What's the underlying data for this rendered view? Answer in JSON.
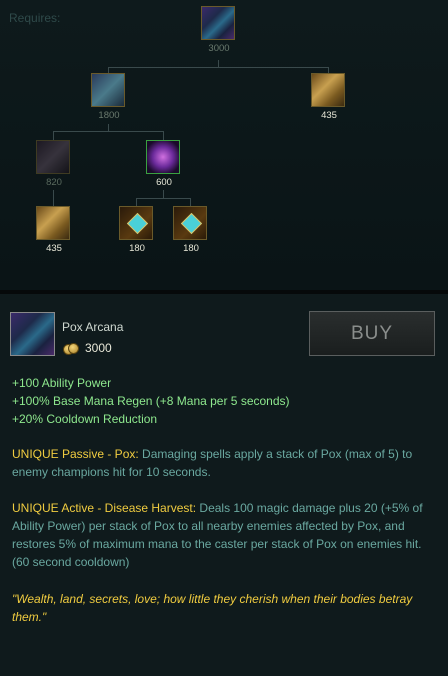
{
  "tree": {
    "requires_label": "Requires:",
    "root": {
      "icon": "pox-arcana-icon",
      "price": "3000"
    },
    "level1": [
      {
        "icon": "blue-tome-icon",
        "price": "1800"
      },
      {
        "icon": "golden-book-icon",
        "price": "435"
      }
    ],
    "level2": [
      {
        "icon": "dark-tome-icon",
        "price": "820"
      },
      {
        "icon": "purple-orb-icon",
        "price": "600"
      }
    ],
    "level3": [
      {
        "icon": "golden-book-icon",
        "price": "435"
      },
      {
        "icon": "blue-gem-icon",
        "price": "180"
      },
      {
        "icon": "blue-gem-icon",
        "price": "180"
      }
    ]
  },
  "item": {
    "name": "Pox Arcana",
    "cost": "3000",
    "buy_label": "BUY",
    "stats": [
      "+100 Ability Power",
      "+100% Base Mana Regen (+8 Mana per 5 seconds)",
      "+20% Cooldown Reduction"
    ],
    "passive": {
      "title": "UNIQUE Passive - Pox:",
      "text": "Damaging spells apply a stack of Pox (max of 5) to enemy champions hit for 10 seconds."
    },
    "active": {
      "title": "UNIQUE Active - Disease Harvest:",
      "text": "Deals 100 magic damage plus 20 (+5% of Ability Power) per stack of Pox to all nearby enemies affected by Pox, and restores 5% of maximum mana to the caster per stack of Pox on enemies hit. (60 second cooldown)"
    },
    "quote": "\"Wealth, land, secrets, love; how little they cherish when their bodies betray them.\""
  },
  "colors": {
    "stat_green": "#8ee88e",
    "unique_gold": "#f0cc40",
    "description_teal": "#6aa8a0"
  }
}
